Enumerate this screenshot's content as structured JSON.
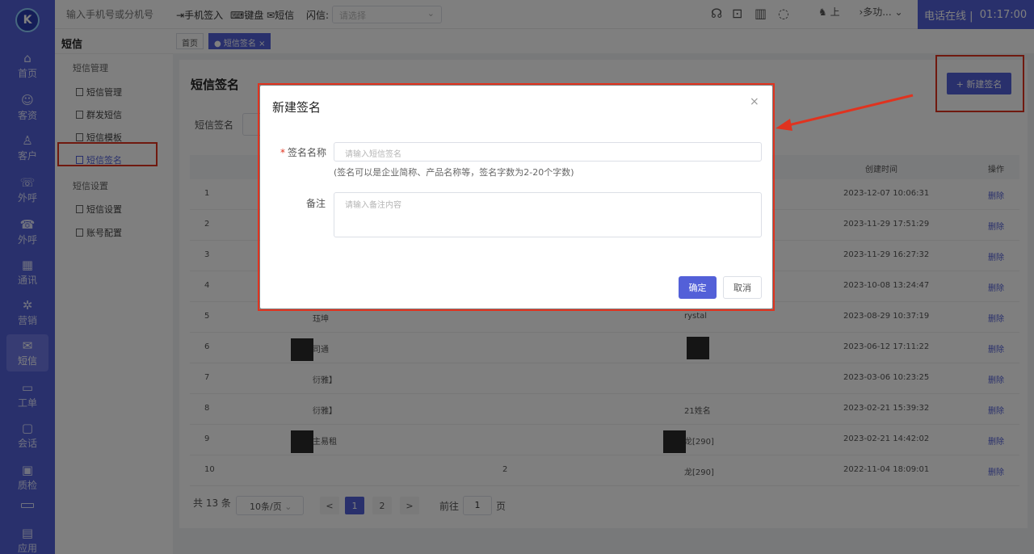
{
  "rail": {
    "logo": "K",
    "items": [
      {
        "label": "首页",
        "icon": "home-icon",
        "glyph": "⌂"
      },
      {
        "label": "客资",
        "icon": "users-icon",
        "glyph": "☺"
      },
      {
        "label": "客户",
        "icon": "person-icon",
        "glyph": "♙"
      },
      {
        "label": "外呼",
        "icon": "phone-out-icon",
        "glyph": "☏"
      },
      {
        "label": "外呼",
        "icon": "phone-call-icon",
        "glyph": "☎"
      },
      {
        "label": "通讯",
        "icon": "contacts-icon",
        "glyph": "▦"
      },
      {
        "label": "营销",
        "icon": "marketing-icon",
        "glyph": "✲"
      },
      {
        "label": "短信",
        "icon": "sms-icon",
        "glyph": "✉"
      },
      {
        "label": "工单",
        "icon": "ticket-icon",
        "glyph": "▭"
      },
      {
        "label": "会话",
        "icon": "chat-icon",
        "glyph": "▢"
      },
      {
        "label": "质检",
        "icon": "inspect-icon",
        "glyph": "▣"
      },
      {
        "label": "应用",
        "icon": "app-icon",
        "glyph": "▤"
      }
    ]
  },
  "topbar": {
    "phone_placeholder": "输入手机号或分机号",
    "signin": "手机签入",
    "keyboard": "键盘",
    "sms": "短信",
    "flash_label": "闪信:",
    "flash_placeholder": "请选择",
    "user_short": "上",
    "more": "›多功...",
    "status": "电话在线 |",
    "timer": "01:17:00"
  },
  "subnav": {
    "title": "短信",
    "groups": [
      {
        "label": "短信管理",
        "items": [
          "短信管理",
          "群发短信",
          "短信模板",
          "短信签名"
        ]
      },
      {
        "label": "短信设置",
        "items": [
          "短信设置",
          "账号配置"
        ]
      }
    ]
  },
  "tabs": {
    "home": "首页",
    "current": "短信签名 ×"
  },
  "page": {
    "title": "短信签名",
    "new_button": "+ 新建签名",
    "filter_label": "短信签名",
    "columns": {
      "created": "创建时间",
      "ops": "操作"
    },
    "rows": [
      {
        "idx": "1",
        "name": "",
        "mid": "",
        "creator": "",
        "time": "2023-12-07 10:06:31",
        "op": "删除"
      },
      {
        "idx": "2",
        "name": "",
        "mid": "",
        "creator": "",
        "time": "2023-11-29 17:51:29",
        "op": "删除"
      },
      {
        "idx": "3",
        "name": "",
        "mid": "",
        "creator": "",
        "time": "2023-11-29 16:27:32",
        "op": "删除"
      },
      {
        "idx": "4",
        "name": "",
        "mid": "",
        "creator": "",
        "time": "2023-10-08 13:24:47",
        "op": "删除"
      },
      {
        "idx": "5",
        "name": "珏坤",
        "mid": "",
        "creator": "rystal",
        "time": "2023-08-29 10:37:19",
        "op": "删除"
      },
      {
        "idx": "6",
        "name": "司通",
        "mid": "",
        "creator": "",
        "time": "2023-06-12 17:11:22",
        "op": "删除"
      },
      {
        "idx": "7",
        "name": "衍雅】",
        "mid": "",
        "creator": "",
        "time": "2023-03-06 10:23:25",
        "op": "删除"
      },
      {
        "idx": "8",
        "name": "衍雅】",
        "mid": "",
        "creator": "21姓名",
        "time": "2023-02-21 15:39:32",
        "op": "删除"
      },
      {
        "idx": "9",
        "name": "主易租",
        "mid": "",
        "creator": "龙[290]",
        "time": "2023-02-21 14:42:02",
        "op": "删除"
      },
      {
        "idx": "10",
        "name": "",
        "mid": "2",
        "creator": "龙[290]",
        "time": "2022-11-04 18:09:01",
        "op": "删除"
      }
    ],
    "pager": {
      "total": "共 13 条",
      "size": "10条/页",
      "pages": [
        "1",
        "2"
      ],
      "prev": "<",
      "next": ">",
      "goto": "前往",
      "current": "1",
      "unit": "页"
    }
  },
  "dialog": {
    "title": "新建签名",
    "close": "×",
    "name_label": "签名名称",
    "name_placeholder": "请输入短信签名",
    "hint": "(签名可以是企业简称、产品名称等，签名字数为2-20个字数)",
    "remark_label": "备注",
    "remark_placeholder": "请输入备注内容",
    "ok": "确定",
    "cancel": "取消"
  },
  "colors": {
    "primary": "#5360d8",
    "highlight_border": "#e0331f",
    "link": "#5360d8"
  }
}
